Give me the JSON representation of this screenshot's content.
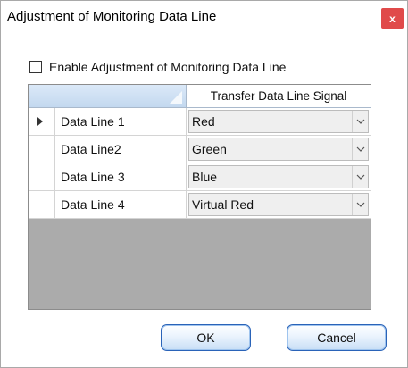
{
  "dialog": {
    "title": "Adjustment of Monitoring Data Line",
    "close_label": "x"
  },
  "enable": {
    "label": "Enable Adjustment of Monitoring Data Line",
    "checked": false
  },
  "grid": {
    "column_header": "Transfer Data Line Signal",
    "rows": [
      {
        "label": "Data Line 1",
        "signal": "Red",
        "current": true
      },
      {
        "label": "Data Line2",
        "signal": "Green",
        "current": false
      },
      {
        "label": "Data Line 3",
        "signal": "Blue",
        "current": false
      },
      {
        "label": "Data Line 4",
        "signal": "Virtual Red",
        "current": false
      }
    ]
  },
  "buttons": {
    "ok": "OK",
    "cancel": "Cancel"
  },
  "colors": {
    "close_bg": "#e04a4a",
    "button_border": "#2a63b8",
    "grid_empty": "#ababab"
  }
}
